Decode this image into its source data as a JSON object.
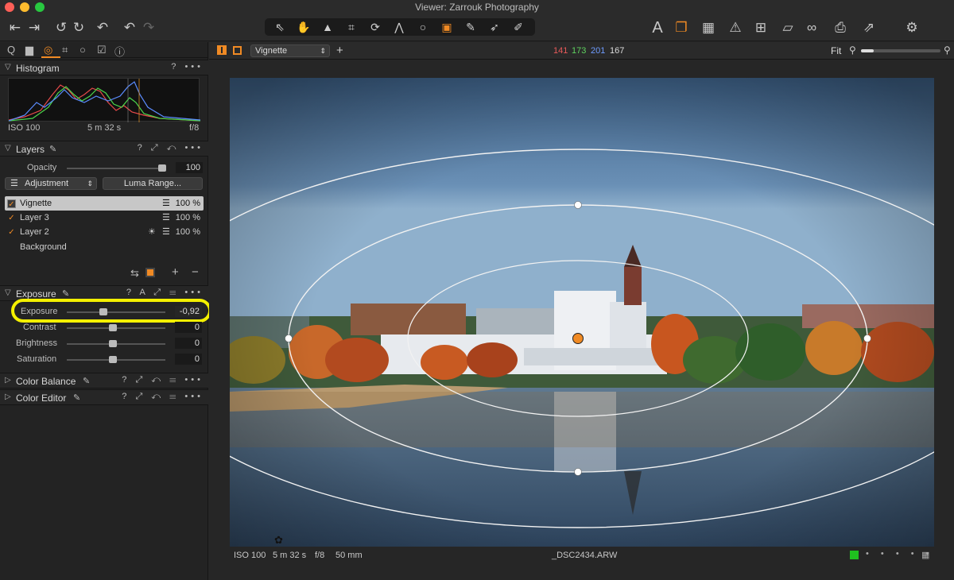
{
  "window": {
    "title": "Viewer: Zarrouk Photography"
  },
  "toolbar": {
    "icons": [
      "import-icon",
      "export-icon",
      "rotate-left-icon",
      "rotate-right-icon",
      "undo-icon",
      "undo-alt-icon",
      "redo-icon"
    ],
    "right_icons": [
      "text-icon",
      "variants-icon",
      "grid-icon",
      "warning-icon",
      "table-icon",
      "edit-icon",
      "glasses-icon",
      "print-icon",
      "arrows-icon",
      "gear-icon"
    ]
  },
  "left": {
    "tabs": [
      "Q",
      "▦",
      "◎",
      "⌗",
      "◌",
      "☑",
      "ⓘ"
    ],
    "histogram": {
      "title": "Histogram",
      "iso": "ISO 100",
      "shutter": "5 m 32 s",
      "aperture": "f/8",
      "help": "?",
      "more": "•••"
    },
    "layers": {
      "title": "Layers",
      "opacity_label": "Opacity",
      "opacity_value": "100",
      "opacity_level": 1.0,
      "adjustment_label": "Adjustment",
      "luma_label": "Luma Range...",
      "items": [
        {
          "name": "Vignette",
          "value": "100 %"
        },
        {
          "name": "Layer 3",
          "value": "100 %"
        },
        {
          "name": "Layer 2",
          "value": "100 %"
        },
        {
          "name": "Background",
          "value": ""
        }
      ]
    },
    "exposure": {
      "title": "Exposure",
      "rows": [
        {
          "label": "Exposure",
          "value": "-0,92",
          "level": 0.4
        },
        {
          "label": "Contrast",
          "value": "0",
          "level": 0.5
        },
        {
          "label": "Brightness",
          "value": "0",
          "level": 0.5
        },
        {
          "label": "Saturation",
          "value": "0",
          "level": 0.5
        }
      ]
    },
    "color_balance": {
      "title": "Color Balance"
    },
    "color_editor": {
      "title": "Color Editor"
    }
  },
  "viewer": {
    "layer_select": "Vignette",
    "readout": {
      "r": "141",
      "g": "173",
      "b": "201",
      "l": "167"
    },
    "zoom": "Fit",
    "meta": {
      "iso": "ISO 100",
      "shutter": "5 m 32 s",
      "aperture": "f/8",
      "focal": "50 mm"
    },
    "filename": "_DSC2434.ARW"
  },
  "colors": {
    "accent": "#f08a24",
    "highlight": "#f4f000",
    "green_tag": "#1fc01f"
  }
}
